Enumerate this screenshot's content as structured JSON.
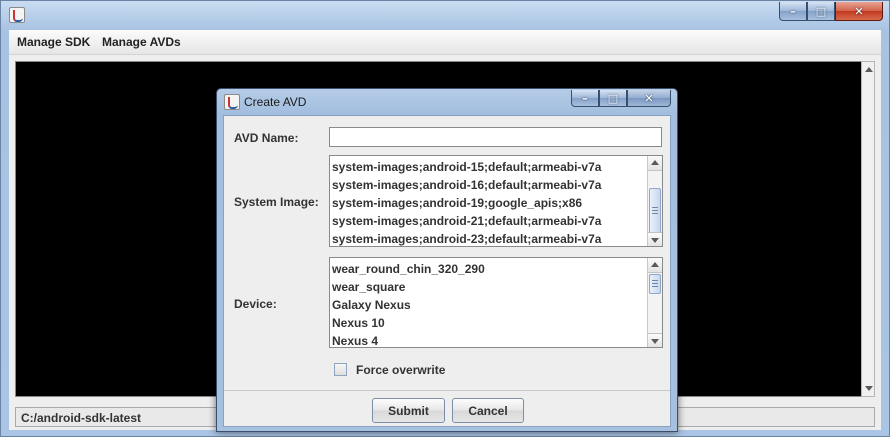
{
  "main_window": {
    "title": "",
    "controls": {
      "minimize_glyph": "–",
      "maximize_glyph": "□",
      "close_glyph": "✕"
    }
  },
  "menubar": {
    "items": [
      {
        "label": "Manage SDK"
      },
      {
        "label": "Manage AVDs"
      }
    ]
  },
  "statusbar": {
    "text": "C:/android-sdk-latest"
  },
  "dialog": {
    "title": "Create AVD",
    "controls": {
      "minimize_glyph": "–",
      "maximize_glyph": "□",
      "close_glyph": "✕"
    },
    "avd_name": {
      "label": "AVD Name:",
      "value": ""
    },
    "system_image": {
      "label": "System Image:",
      "options": [
        "system-images;android-15;default;armeabi-v7a",
        "system-images;android-16;default;armeabi-v7a",
        "system-images;android-19;google_apis;x86",
        "system-images;android-21;default;armeabi-v7a",
        "system-images;android-23;default;armeabi-v7a"
      ]
    },
    "device": {
      "label": "Device:",
      "options": [
        "wear_round_chin_320_290",
        "wear_square",
        "Galaxy Nexus",
        "Nexus 10",
        "Nexus 4"
      ]
    },
    "force_overwrite": {
      "label": "Force overwrite",
      "checked": false
    },
    "buttons": {
      "submit": "Submit",
      "cancel": "Cancel"
    }
  },
  "icons": {
    "window": "java-app-icon",
    "scroll_up": "arrow-up-icon",
    "scroll_down": "arrow-down-icon"
  }
}
